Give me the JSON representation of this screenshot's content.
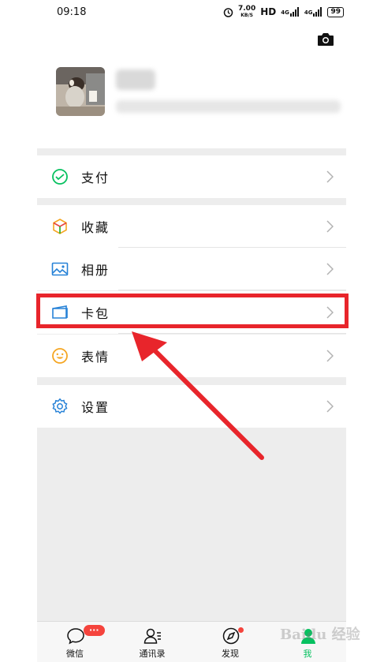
{
  "status_bar": {
    "time": "09:18",
    "speed_value": "7.00",
    "speed_unit": "KB/S",
    "hd": "HD",
    "network1": "4G",
    "network2": "4G",
    "battery": "99"
  },
  "menu": {
    "pay": "支付",
    "favorites": "收藏",
    "album": "相册",
    "card_wallet": "卡包",
    "stickers": "表情",
    "settings": "设置"
  },
  "tabbar": {
    "chats": "微信",
    "chats_badge": "···",
    "contacts": "通讯录",
    "discover": "发现",
    "me": "我"
  },
  "watermark": "Baidu 经验",
  "colors": {
    "wechat_green": "#07c160",
    "highlight_red": "#e8252b",
    "panel_gray": "#ededed"
  }
}
